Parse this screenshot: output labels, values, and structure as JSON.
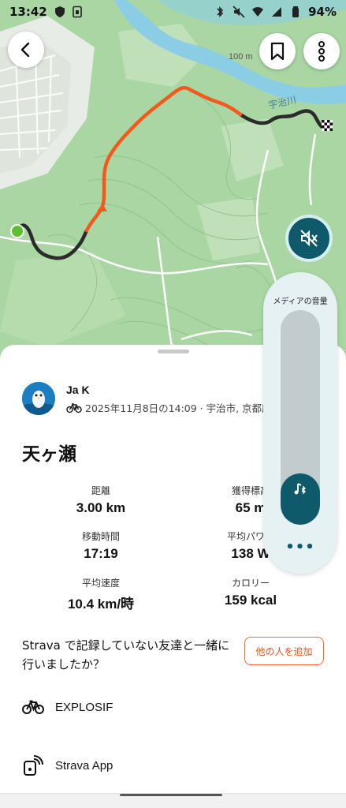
{
  "status_bar": {
    "time": "13:42",
    "battery": "94%"
  },
  "map": {
    "contour_label": "100 m",
    "river_label": "宇治川",
    "colors": {
      "forest": "#a9d6a3",
      "river": "#8ccde6",
      "route_elevated": "#f2591c",
      "route_default": "#2b2b2b",
      "start_marker": "#5bbf2f"
    }
  },
  "map_controls": {
    "back_icon": "chevron-left-icon",
    "bookmark_icon": "bookmark-icon",
    "more_icon": "more-vertical-icon",
    "mute_icon": "speaker-muted-icon"
  },
  "activity": {
    "athlete_name": "Ja K",
    "sport_icon": "bicycle-icon",
    "meta": "2025年11月8日の14:09 · 宇治市, 京都府",
    "title": "天ヶ瀬",
    "stats": [
      {
        "label": "距離",
        "value": "3.00 km"
      },
      {
        "label": "獲得標高",
        "value": "65 m"
      },
      {
        "label": "移動時間",
        "value": "17:19"
      },
      {
        "label": "平均パワー",
        "value": "138 W"
      },
      {
        "label": "平均速度",
        "value": "10.4 km/時"
      },
      {
        "label": "カロリー",
        "value": "159 kcal"
      }
    ]
  },
  "companions": {
    "prompt": "Strava で記録していない友達と一緒に行いましたか？",
    "add_button": "他の人を追加"
  },
  "gear": {
    "bike_name": "EXPLOSIF",
    "device_name": "Strava App"
  },
  "volume_panel": {
    "title": "メディアの音量",
    "level_percent": 24,
    "more_icon": "more-horizontal-icon"
  }
}
